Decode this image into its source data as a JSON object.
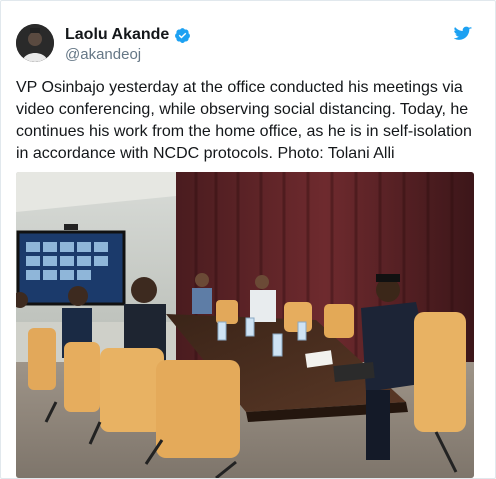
{
  "tweet": {
    "display_name": "Laolu Akande",
    "handle": "@akandeoj",
    "verified": true,
    "text": "VP Osinbajo yesterday at the office conducted his meetings via video conferencing, while observing social distancing. Today, he continues his work from the home office, as he is in self-isolation in accordance with NCDC protocols. Photo: Tolani Alli",
    "icons": {
      "avatar": "profile-photo",
      "verified": "verified-badge-icon",
      "brand": "twitter-bird-icon"
    }
  },
  "colors": {
    "twitter_blue": "#1da1f2",
    "text": "#14171a",
    "secondary_text": "#657786",
    "border": "#e1e8ed"
  }
}
